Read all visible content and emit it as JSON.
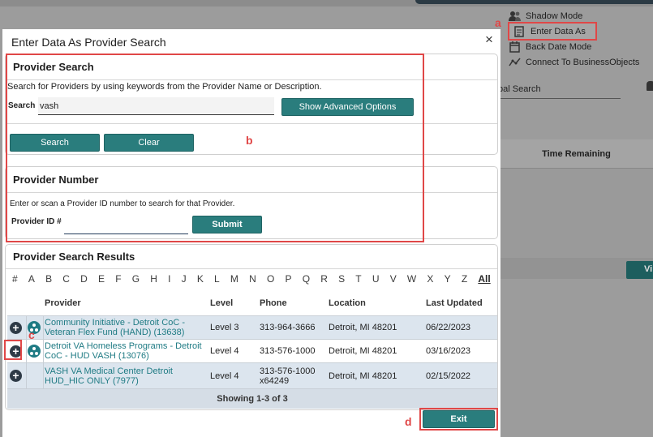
{
  "background": {
    "menu": [
      {
        "label": "Shadow Mode",
        "icon": "shadow-user-icon"
      },
      {
        "label": "Enter Data As",
        "icon": "enter-data-icon"
      },
      {
        "label": "Back Date Mode",
        "icon": "calendar-icon"
      },
      {
        "label": "Connect To BusinessObjects",
        "icon": "chart-icon"
      }
    ],
    "global_search": "bal Search",
    "time_remaining_header": "Time Remaining",
    "button_fragment": "Vi"
  },
  "modal": {
    "title": "Enter Data As Provider Search",
    "close_glyph": "×",
    "provider_search": {
      "heading": "Provider Search",
      "description": "Search for Providers by using keywords from the Provider Name or Description.",
      "search_label": "Search",
      "search_value": "vash",
      "advanced_button": "Show Advanced Options",
      "search_button": "Search",
      "clear_button": "Clear"
    },
    "provider_number": {
      "heading": "Provider Number",
      "description": "Enter or scan a Provider ID number to search for that Provider.",
      "id_label": "Provider ID #",
      "id_value": "",
      "submit_button": "Submit"
    },
    "results": {
      "heading": "Provider Search Results",
      "alphabet": [
        "#",
        "A",
        "B",
        "C",
        "D",
        "E",
        "F",
        "G",
        "H",
        "I",
        "J",
        "K",
        "L",
        "M",
        "N",
        "O",
        "P",
        "Q",
        "R",
        "S",
        "T",
        "U",
        "V",
        "W",
        "X",
        "Y",
        "Z",
        "All"
      ],
      "columns": [
        "Provider",
        "Level",
        "Phone",
        "Location",
        "Last Updated"
      ],
      "rows": [
        {
          "provider": "Community Initiative - Detroit CoC - Veteran Flex Fund (HAND) (13638)",
          "level": "Level 3",
          "phone": "313-964-3666",
          "location": "Detroit, MI 48201",
          "updated": "06/22/2023",
          "has_org_icon": true
        },
        {
          "provider": "Detroit VA Homeless Programs - Detroit CoC - HUD VASH (13076)",
          "level": "Level 4",
          "phone": "313-576-1000",
          "location": "Detroit, MI 48201",
          "updated": "03/16/2023",
          "has_org_icon": true
        },
        {
          "provider": "VASH VA Medical Center Detroit HUD_HIC ONLY (7977)",
          "level": "Level 4",
          "phone": "313-576-1000 x64249",
          "location": "Detroit, MI 48201",
          "updated": "02/15/2022",
          "has_org_icon": false
        }
      ],
      "footer": "Showing 1-3 of 3"
    },
    "exit_button": "Exit"
  },
  "annotations": {
    "a": "a",
    "b": "b",
    "c": "c",
    "d": "d",
    "color": "#e04747"
  },
  "colors": {
    "button_teal": "#2a7d7d",
    "link_teal": "#1f7b84",
    "row_blue": "#dce5ee"
  }
}
